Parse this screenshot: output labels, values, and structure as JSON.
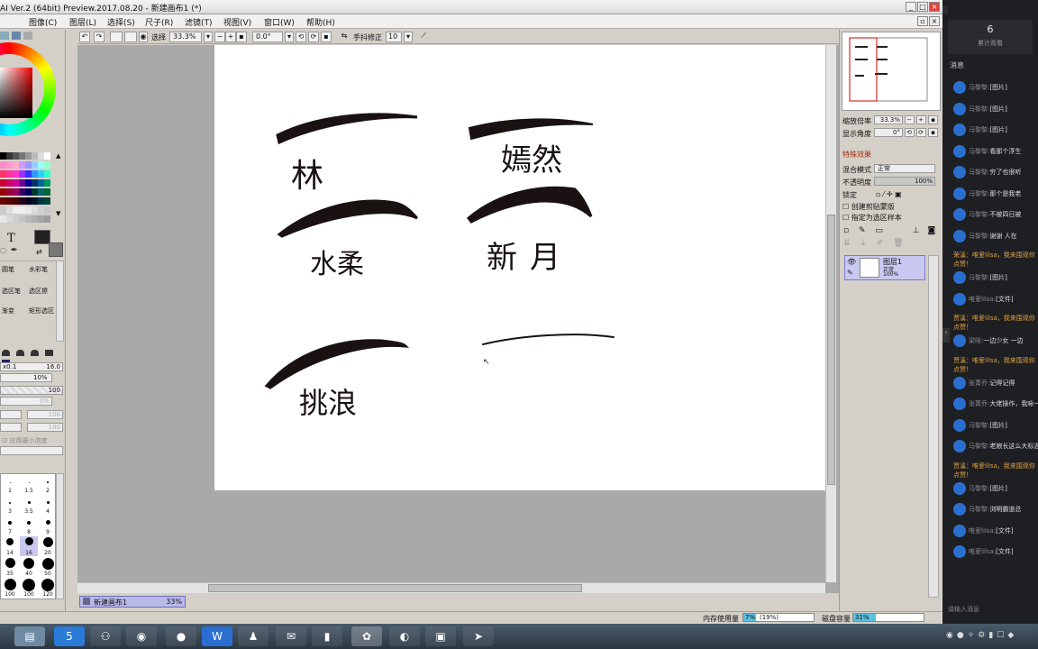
{
  "window": {
    "title": "AI Ver.2 (64bit) Preview.2017.08.20 - 新建画布1 (*)"
  },
  "menu": [
    "图像(C)",
    "图层(L)",
    "选择(S)",
    "尺子(R)",
    "滤镜(T)",
    "视图(V)",
    "窗口(W)",
    "帮助(H)"
  ],
  "toolbar": {
    "select_label": "选择",
    "zoom": "33.3%",
    "angle": "0.0°",
    "stabilizer_label": "手抖修正",
    "stabilizer_value": "10"
  },
  "leftpanel": {
    "text_tool": "T",
    "brushes": [
      [
        "圆笔",
        "水彩笔"
      ],
      [
        "选区笔",
        "选区擦"
      ],
      [
        "渐变",
        "矩形选区"
      ]
    ],
    "size_row": [
      "x0.1",
      "16.0"
    ],
    "density": "10%",
    "pct100": "100",
    "pct0": "0%",
    "pct100b": "100",
    "pct100c": "100",
    "apply_label": "应用最小浓度",
    "dots": [
      [
        "1",
        "1.5",
        "2"
      ],
      [
        "3",
        "3.5",
        "4"
      ],
      [
        "7",
        "8",
        "9"
      ],
      [
        "14",
        "16",
        "20"
      ],
      [
        "35",
        "40",
        "50"
      ],
      [
        "100",
        "100",
        "120"
      ]
    ]
  },
  "canvas": {
    "tab_name": "新建画布1",
    "tab_zoom": "33%",
    "words": [
      [
        "林",
        "嫣然"
      ],
      [
        "水柔",
        "新月"
      ],
      [
        "挑浪",
        ""
      ]
    ]
  },
  "rightpanel": {
    "zoom_label": "缩放倍率",
    "zoom_value": "33.3%",
    "angle_label": "显示角度",
    "angle_value": "0°",
    "effects_label": "特殊效果",
    "blend_label": "混合模式",
    "blend_value": "正常",
    "opacity_label": "不透明度",
    "opacity_value": "100%",
    "lock_label": "锁定",
    "clip_label": "创建剪贴蒙版",
    "ref_label": "指定为选区样本",
    "layer_name": "图层1",
    "layer_mode": "正常",
    "layer_opacity": "100%"
  },
  "status": {
    "mem_label": "内存使用量",
    "mem_value": "7%",
    "mem_paren": "(19%)",
    "disk_label": "磁盘容量",
    "disk_value": "31%"
  },
  "chat": {
    "viewer_count": "6",
    "viewer_label": "累计观看",
    "section": "消息",
    "input_placeholder": "请输入消息",
    "messages": [
      {
        "name": "马黎黎:",
        "text": "[图片]",
        "warn": false
      },
      {
        "name": "马黎黎:",
        "text": "[图片]",
        "warn": false
      },
      {
        "name": "马黎黎:",
        "text": "[图片]",
        "warn": false
      },
      {
        "name": "马黎黎:",
        "text": "看那个浮生",
        "warn": false
      },
      {
        "name": "马黎黎:",
        "text": "穷了也很听",
        "warn": false
      },
      {
        "name": "马黎黎:",
        "text": "那个是我老",
        "warn": false
      },
      {
        "name": "马黎黎:",
        "text": "不被四日被",
        "warn": false
      },
      {
        "name": "马黎黎:",
        "text": "谢谢 人在",
        "warn": false
      },
      {
        "name": "",
        "text": "荣溪：唯爱lilsa，我来围观你点赞！",
        "warn": true
      },
      {
        "name": "马黎黎:",
        "text": "[图片]",
        "warn": false
      },
      {
        "name": "唯爱lilsa:",
        "text": "[文件]",
        "warn": false
      },
      {
        "name": "",
        "text": "贾溪：唯爱lilsa，我来围观你点赞！",
        "warn": true
      },
      {
        "name": "梁晗:",
        "text": "一边少女 一边",
        "warn": false
      },
      {
        "name": "",
        "text": "贾溪：唯爱lilsa，我来围观你点赞！",
        "warn": true
      },
      {
        "name": "张菁乔:",
        "text": "记得记得",
        "warn": false
      },
      {
        "name": "张菁乔:",
        "text": "大佬操作，我咏一下",
        "warn": false
      },
      {
        "name": "马黎黎:",
        "text": "[图片]",
        "warn": false
      },
      {
        "name": "马黎黎:",
        "text": "老娘长这么大标志的人儿",
        "warn": false
      },
      {
        "name": "",
        "text": "贾溪：唯爱lilsa，我来围观你点赞！",
        "warn": true
      },
      {
        "name": "马黎黎:",
        "text": "[图片]",
        "warn": false
      },
      {
        "name": "马黎黎:",
        "text": "浏明霸道总",
        "warn": false
      },
      {
        "name": "唯爱lilsa:",
        "text": "[文件]",
        "warn": false
      },
      {
        "name": "唯爱lilsa:",
        "text": "[文件]",
        "warn": false
      }
    ]
  }
}
